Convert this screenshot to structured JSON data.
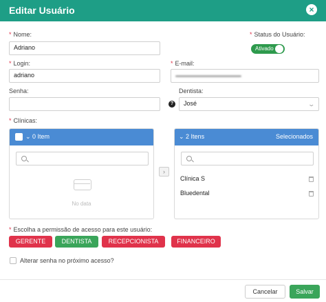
{
  "dialog": {
    "title": "Editar Usuário"
  },
  "form": {
    "nome_label": "Nome:",
    "nome_value": "Adriano",
    "status_label": "Status do Usuário:",
    "status_value": "Ativado",
    "login_label": "Login:",
    "login_value": "adriano",
    "email_label": "E-mail:",
    "senha_label": "Senha:",
    "dentista_label": "Dentista:",
    "dentista_value": "José",
    "clinicas_label": "Clínicas:"
  },
  "transfer": {
    "left": {
      "header": "0 Item",
      "empty_text": "No data"
    },
    "right": {
      "header": "2 Itens",
      "header_right": "Selecionados",
      "items": [
        "Clínica S",
        "Bluedental"
      ]
    }
  },
  "permissions": {
    "label": "Escolha a permissão de acesso para este usuário:",
    "roles": [
      "GERENTE",
      "DENTISTA",
      "RECEPCIONISTA",
      "FINANCEIRO"
    ]
  },
  "change_password": {
    "label": "Alterar senha no próximo acesso?"
  },
  "footer": {
    "cancel_label": "Cancelar",
    "save_label": "Salvar"
  },
  "colors": {
    "header": "#1e9e86",
    "accent_blue": "#4a8bd4",
    "danger": "#e0334b",
    "success": "#3aa55a"
  }
}
